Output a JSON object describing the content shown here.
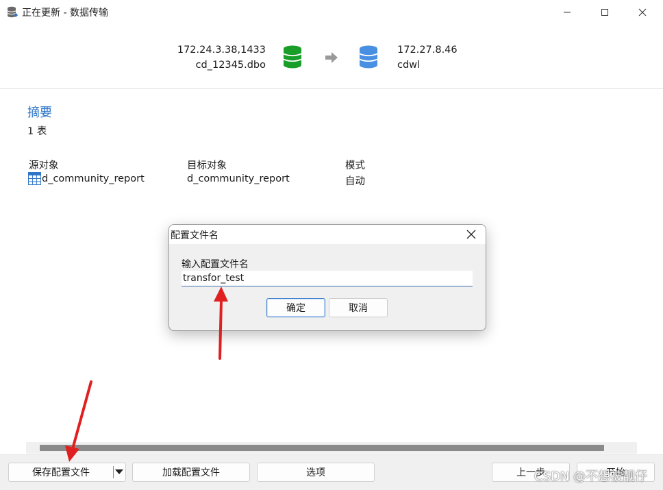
{
  "window": {
    "title": "正在更新 - 数据传输",
    "minimize_glyph": "—",
    "maximize_glyph": "☐",
    "close_glyph": "✕"
  },
  "connection": {
    "source_host": "172.24.3.38,1433",
    "source_db": "cd_12345.dbo",
    "target_host": "172.27.8.46",
    "target_db": "cdwl",
    "source_icon": "database-green-icon",
    "arrow_icon": "arrow-right-icon",
    "target_icon": "database-blue-icon"
  },
  "summary": {
    "title": "摘要",
    "count": "1 表",
    "columns": {
      "source": "源对象",
      "target": "目标对象",
      "mode": "模式"
    },
    "rows": [
      {
        "source": "d_community_report",
        "target": "d_community_report",
        "mode": "自动",
        "icon": "table-icon"
      }
    ]
  },
  "dialog": {
    "title": "配置文件名",
    "label": "输入配置文件名",
    "input_value": "transfor_test",
    "ok": "确定",
    "cancel": "取消"
  },
  "footer": {
    "save_profile": "保存配置文件",
    "load_profile": "加载配置文件",
    "options": "选项",
    "back": "上一步",
    "start": "开始"
  },
  "watermark": "CSDN @不想被靓仔",
  "colors": {
    "accent": "#2e76c6",
    "source_db": "#1a9e2a",
    "target_db": "#4a90e2",
    "annotation_arrow": "#e02020"
  }
}
